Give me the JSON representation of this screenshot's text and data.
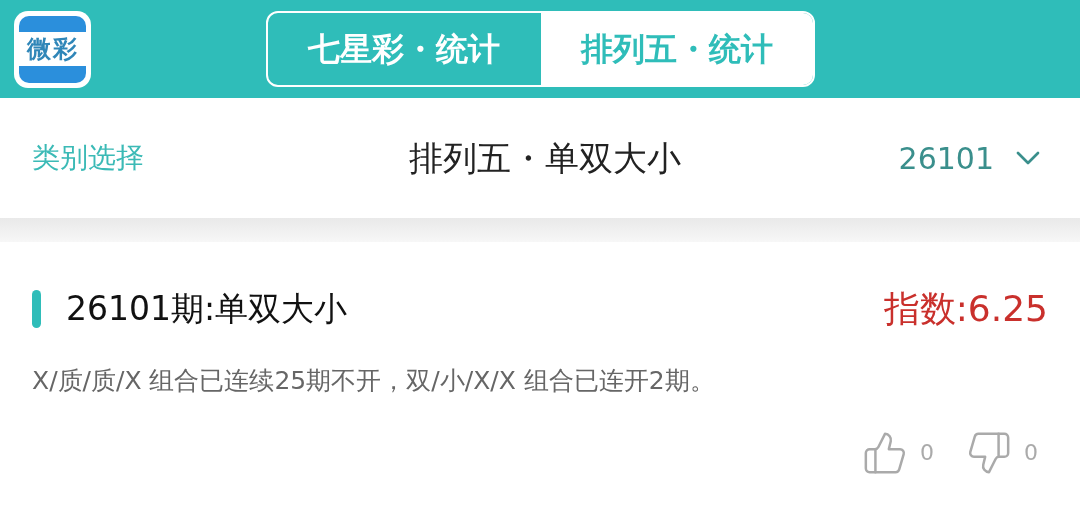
{
  "app_logo": {
    "text": "微彩"
  },
  "tabs": [
    {
      "label": "七星彩・统计",
      "selected": false
    },
    {
      "label": "排列五・统计",
      "selected": true
    }
  ],
  "toolbar": {
    "category_link": "类别选择",
    "title": "排列五・单双大小",
    "issue": "26101"
  },
  "article": {
    "title": "26101期:单双大小",
    "index": "指数:6.25",
    "body": "X/质/质/X 组合已连续25期不开，双/小/X/X 组合已连开2期。",
    "likes": "0",
    "dislikes": "0"
  }
}
